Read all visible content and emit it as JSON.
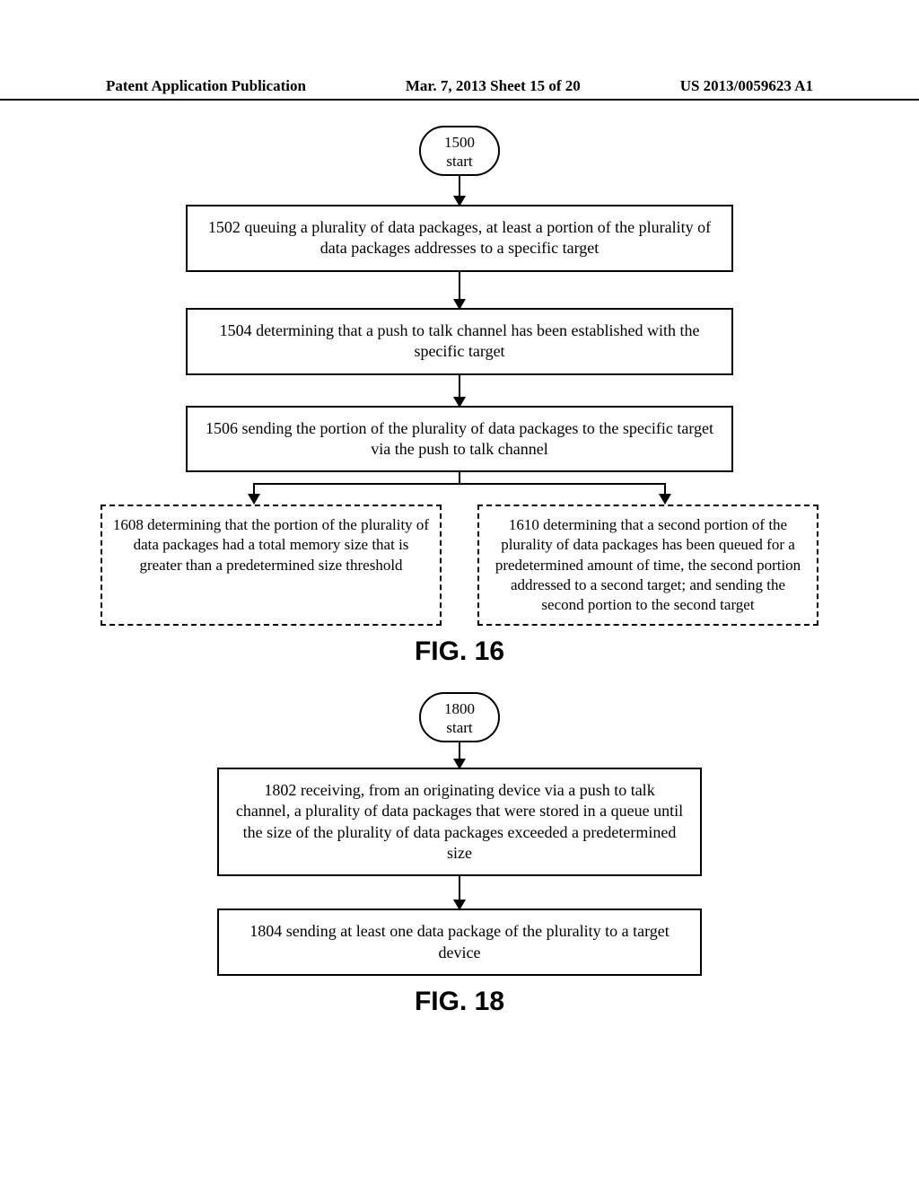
{
  "header": {
    "left": "Patent Application Publication",
    "mid": "Mar. 7, 2013  Sheet 15 of 20",
    "right": "US 2013/0059623 A1"
  },
  "fig16": {
    "start_num": "1500",
    "start_label": "start",
    "step1": "1502 queuing a plurality of data packages, at least a portion of the plurality of data packages addresses to a specific target",
    "step2": "1504 determining that a push to talk channel has been established with the specific target",
    "step3": "1506 sending the portion of the plurality of data packages to the specific target via the push to talk channel",
    "dash_left": "1608 determining that the portion of the plurality of data packages had a total memory size that is greater than a predetermined size threshold",
    "dash_right": "1610 determining that a second portion of the plurality of data packages has been queued for a predetermined amount of time, the second portion addressed to a second target; and sending the second portion to the second target",
    "label": "FIG. 16"
  },
  "fig18": {
    "start_num": "1800",
    "start_label": "start",
    "step1": "1802 receiving, from an originating device via a push to talk channel, a plurality of data packages that were stored in a queue until the size of the plurality of data packages exceeded a predetermined size",
    "step2": "1804 sending at least one data package of the plurality to a target device",
    "label": "FIG. 18"
  }
}
